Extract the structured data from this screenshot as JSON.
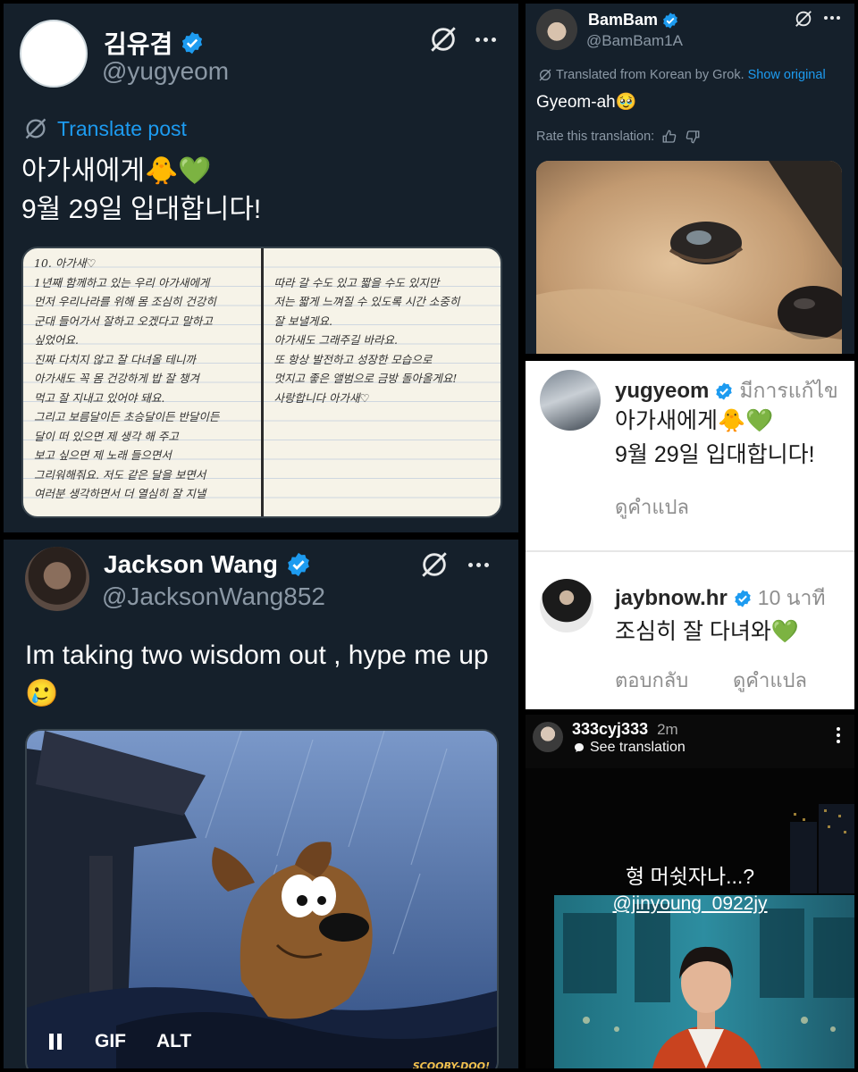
{
  "yugyeom_post": {
    "display_name": "김유겸",
    "handle": "@yugyeom",
    "translate_label": "Translate post",
    "line1": "아가새에게🐥💚",
    "line2": "9월 29일 입대합니다!",
    "letter_left": "10. 아가새♡\n1년째 함께하고 있는 우리 아가새에게\n먼저 우리나라를 위해 몸 조심히 건강히\n군대 들어가서 잘하고 오겠다고 말하고\n싶었어요.\n진짜 다치지 않고 잘 다녀올 테니까\n아가새도 꼭 몸 건강하게 밥 잘 챙겨\n먹고 잘 지내고 있어야 돼요.\n그리고 보름달이든 초승달이든 반달이든\n달이 떠 있으면 제 생각 해 주고\n보고 싶으면 제 노래 들으면서\n그리워해줘요. 저도 같은 달을 보면서\n여러분 생각하면서 더 열심히 잘 지낼",
    "letter_right": "\n따라 갈 수도 있고 짧을 수도 있지만\n저는 짧게 느껴질 수 있도록 시간 소중히\n잘 보낼게요.\n아가새도 그래주길 바라요.\n또 항상 발전하고 성장한 모습으로\n멋지고 좋은 앨범으로 금방 돌아올게요!\n사랑합니다 아가새♡"
  },
  "bambam_post": {
    "display_name": "BamBam",
    "handle": "@BamBam1A",
    "translated_note": "Translated from Korean by Grok.",
    "show_original": "Show original",
    "text": "Gyeom-ah🥹",
    "rate_label": "Rate this translation:"
  },
  "ig_comments": {
    "c1": {
      "username": "yugyeom",
      "meta": "มีการแก้ไข",
      "line1": "아가새에게🐥💚",
      "line2": "9월 29일 입대합니다!",
      "action": "ดูคำแปล"
    },
    "c2": {
      "username": "jaybnow.hr",
      "meta": "10 นาที",
      "text": "조심히 잘 다녀와💚",
      "reply": "ตอบกลับ",
      "translate": "ดูคำแปล"
    }
  },
  "jackson_post": {
    "display_name": "Jackson Wang",
    "handle": "@JacksonWang852",
    "text": "Im taking two wisdom out , hype me up 🥲",
    "gif_label": "GIF",
    "alt_label": "ALT",
    "gif_brand": "SCOOBY-DOO!"
  },
  "story": {
    "username": "333cyj333",
    "time": "2m",
    "see_translation": "See translation",
    "caption": "형 머쉿자나...?",
    "mention": "@jinyoung_0922jy"
  },
  "colors": {
    "tweet_bg": "#15202b",
    "accent_blue": "#1d9bf0",
    "verified_blue": "#1d9bf0"
  }
}
